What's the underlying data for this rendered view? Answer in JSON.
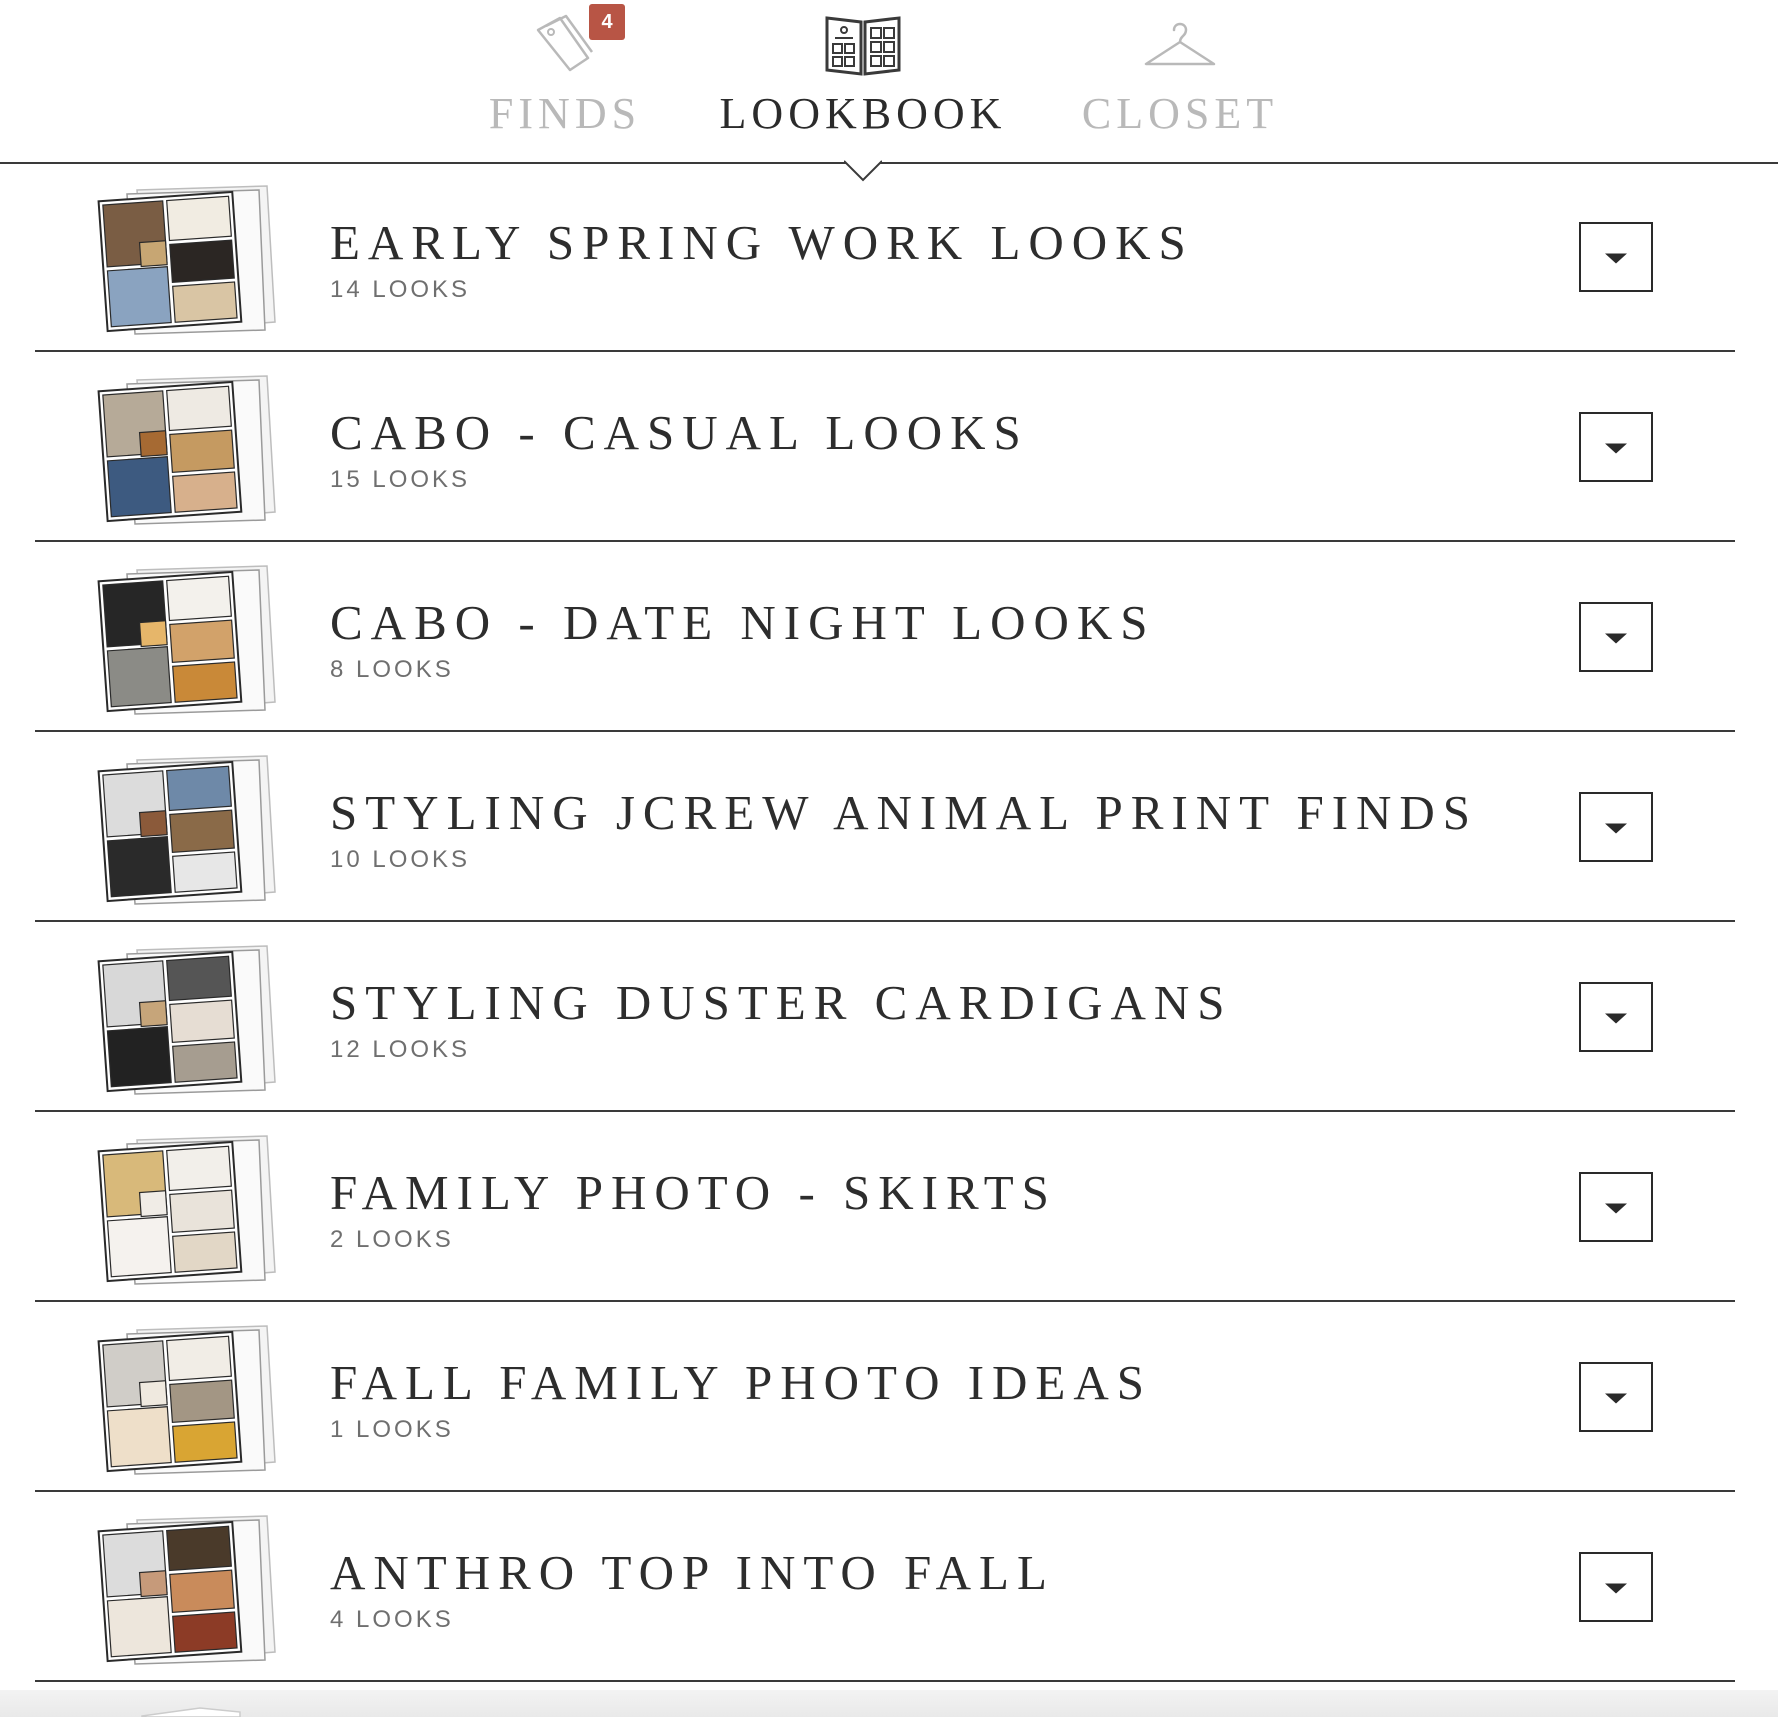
{
  "tabs": [
    {
      "label": "FINDS",
      "icon": "tags-icon",
      "active": false,
      "badge": "4"
    },
    {
      "label": "LOOKBOOK",
      "icon": "lookbook-icon",
      "active": true
    },
    {
      "label": "CLOSET",
      "icon": "hanger-icon",
      "active": false
    }
  ],
  "lookbooks": [
    {
      "title": "EARLY SPRING WORK LOOKS",
      "count": "14 LOOKS",
      "palette": [
        "#7a5d44",
        "#f1ece2",
        "#2b2623",
        "#8aa3c0",
        "#d9c5a4",
        "#c7a673"
      ]
    },
    {
      "title": "CABO - CASUAL LOOKS",
      "count": "15 LOOKS",
      "palette": [
        "#b6aa98",
        "#eeeae3",
        "#c59a61",
        "#3d5a80",
        "#d7b08c",
        "#a66a33"
      ]
    },
    {
      "title": "CABO - DATE NIGHT LOOKS",
      "count": "8 LOOKS",
      "palette": [
        "#262626",
        "#f3f1ec",
        "#d2a26a",
        "#8b8b86",
        "#c98938",
        "#e6b66a"
      ]
    },
    {
      "title": "STYLING JCREW ANIMAL PRINT FINDS",
      "count": "10 LOOKS",
      "palette": [
        "#dcdcdc",
        "#6e89a8",
        "#8a6a48",
        "#2a2a2a",
        "#e7e7e7",
        "#8b5a3a"
      ]
    },
    {
      "title": "STYLING DUSTER CARDIGANS",
      "count": "12 LOOKS",
      "palette": [
        "#d8d8d8",
        "#555555",
        "#e6ddd3",
        "#222222",
        "#a69d90",
        "#c6a57a"
      ]
    },
    {
      "title": "FAMILY PHOTO - SKIRTS",
      "count": "2 LOOKS",
      "palette": [
        "#d8b97a",
        "#f2efea",
        "#e9e3da",
        "#f5f2ee",
        "#e2d7c6",
        "#f0ece6"
      ]
    },
    {
      "title": "FALL FAMILY PHOTO IDEAS",
      "count": "1 LOOKS",
      "palette": [
        "#d0cdc8",
        "#f1ede6",
        "#a39684",
        "#eedfc9",
        "#d9a533",
        "#efe9df"
      ]
    },
    {
      "title": "ANTHRO TOP INTO FALL",
      "count": "4 LOOKS",
      "palette": [
        "#dcdcdc",
        "#4a3a2a",
        "#c98b5b",
        "#ede6dc",
        "#8c3b26",
        "#c69a7a"
      ]
    }
  ],
  "colors": {
    "badge": "#b85545",
    "divider": "#3a3a3a",
    "inactive_tab": "#b9b9b9",
    "active_tab": "#2b2b2b"
  }
}
